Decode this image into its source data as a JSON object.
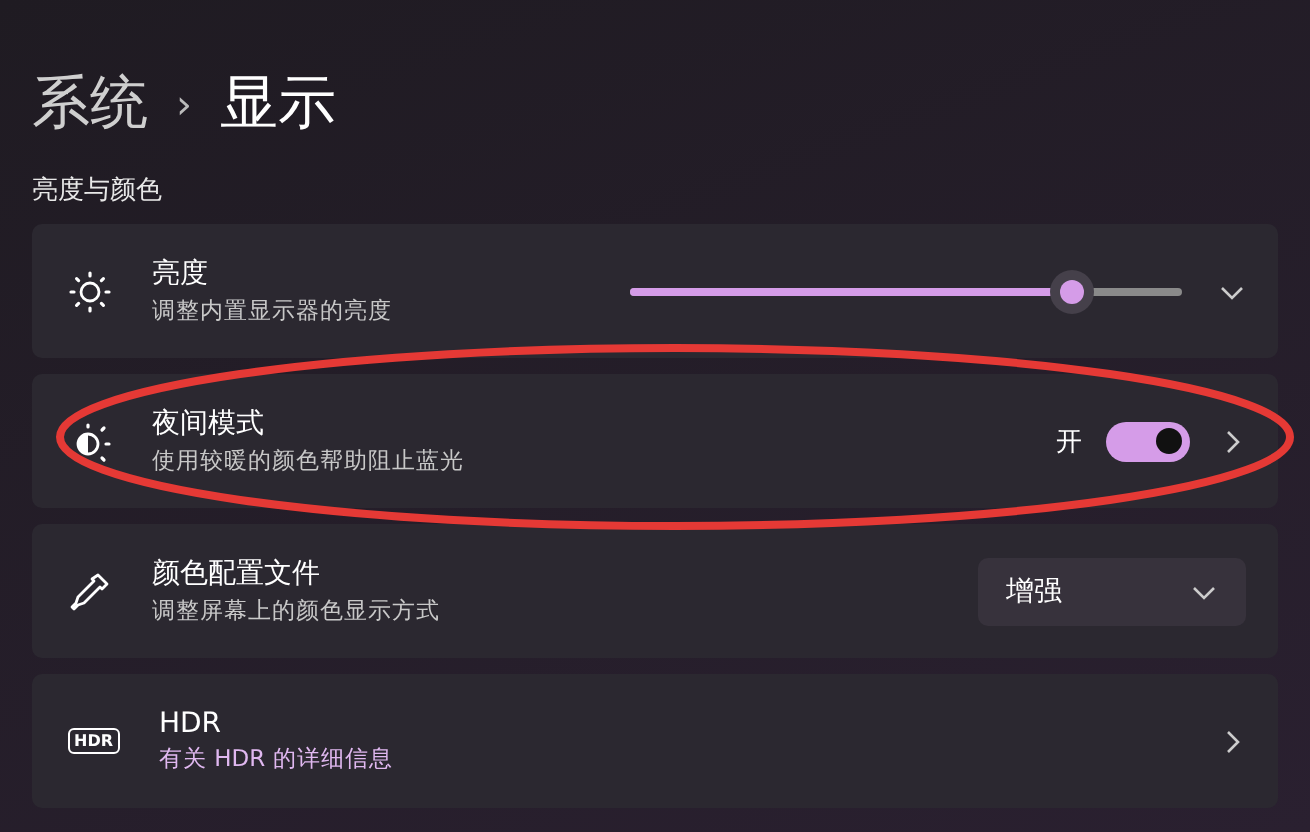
{
  "breadcrumb": {
    "parent": "系统",
    "separator": "›",
    "current": "显示"
  },
  "section_title": "亮度与颜色",
  "rows": [
    {
      "kind": "slider",
      "title": "亮度",
      "subtitle": "调整内置显示器的亮度",
      "level": 0.8,
      "highlighted": false
    },
    {
      "kind": "toggle",
      "title": "夜间模式",
      "subtitle": "使用较暖的颜色帮助阻止蓝光",
      "state_label": "开",
      "on": true,
      "highlighted": true
    },
    {
      "kind": "dropdown",
      "title": "颜色配置文件",
      "subtitle": "调整屏幕上的颜色显示方式",
      "value": "增强",
      "highlighted": false
    },
    {
      "kind": "link",
      "icon_text": "HDR",
      "title": "HDR",
      "subtitle": "有关 HDR 的详细信息",
      "highlighted": false
    }
  ]
}
